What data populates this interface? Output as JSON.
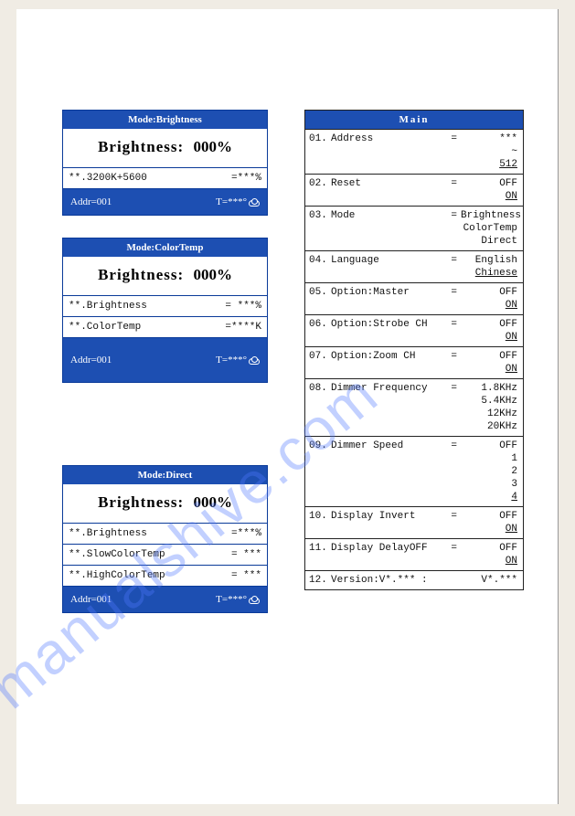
{
  "watermark": "manualshive.com",
  "panels": {
    "brightness": {
      "title": "Mode:Brightness",
      "big_label": "Brightness:",
      "big_value": "000%",
      "rows": [
        {
          "name": "**.3200K+5600",
          "value": "=***%"
        }
      ],
      "addr": "Addr=001",
      "temp": "T=***°"
    },
    "colortemp": {
      "title": "Mode:ColorTemp",
      "big_label": "Brightness:",
      "big_value": "000%",
      "rows": [
        {
          "name": "**.Brightness",
          "value": "= ***%"
        },
        {
          "name": "**.ColorTemp",
          "value": "=****K"
        }
      ],
      "addr": "Addr=001",
      "temp": "T=***°"
    },
    "direct": {
      "title": "Mode:Direct",
      "big_label": "Brightness:",
      "big_value": "000%",
      "rows": [
        {
          "name": "**.Brightness",
          "value": "=***%"
        },
        {
          "name": "**.SlowColorTemp",
          "value": "= ***"
        },
        {
          "name": "**.HighColorTemp",
          "value": "= ***"
        }
      ],
      "addr": "Addr=001",
      "temp": "T=***°"
    }
  },
  "menu": {
    "title": "Main",
    "items": [
      {
        "num": "01.",
        "name": "Address",
        "eq": "=",
        "val": "***",
        "extra": [
          "~",
          "512"
        ],
        "u": [
          false,
          true
        ]
      },
      {
        "num": "02.",
        "name": "Reset",
        "eq": "=",
        "val": "OFF",
        "extra": [
          "ON"
        ],
        "u": [
          true
        ]
      },
      {
        "num": "03.",
        "name": "Mode",
        "eq": "=",
        "val": "Brightness",
        "extra": [
          "ColorTemp",
          "Direct"
        ],
        "u": [
          false,
          false
        ]
      },
      {
        "num": "04.",
        "name": "Language",
        "eq": "=",
        "val": "English",
        "extra": [
          "Chinese"
        ],
        "u": [
          true
        ]
      },
      {
        "num": "05.",
        "name": "Option:Master",
        "eq": "=",
        "val": "OFF",
        "extra": [
          "ON"
        ],
        "u": [
          true
        ]
      },
      {
        "num": "06.",
        "name": "Option:Strobe CH",
        "eq": "=",
        "val": "OFF",
        "extra": [
          "ON"
        ],
        "u": [
          true
        ]
      },
      {
        "num": "07.",
        "name": "Option:Zoom CH",
        "eq": "=",
        "val": "OFF",
        "extra": [
          "ON"
        ],
        "u": [
          true
        ]
      },
      {
        "num": "08.",
        "name": "Dimmer Frequency",
        "eq": "=",
        "val": "1.8KHz",
        "extra": [
          "5.4KHz",
          "12KHz",
          "20KHz"
        ],
        "u": [
          false,
          false,
          false
        ]
      },
      {
        "num": "09.",
        "name": "Dimmer Speed",
        "eq": "=",
        "val": "OFF",
        "extra": [
          "1",
          "2",
          "3",
          "4"
        ],
        "u": [
          false,
          false,
          false,
          true
        ]
      },
      {
        "num": "10.",
        "name": "Display Invert",
        "eq": "=",
        "val": "OFF",
        "extra": [
          "ON"
        ],
        "u": [
          true
        ]
      },
      {
        "num": "11.",
        "name": "Display DelayOFF",
        "eq": "=",
        "val": "OFF",
        "extra": [
          "ON"
        ],
        "u": [
          true
        ]
      },
      {
        "num": "12.",
        "name": "Version:V*.*** :",
        "eq": "",
        "val": "V*.***",
        "extra": [],
        "u": []
      }
    ]
  }
}
